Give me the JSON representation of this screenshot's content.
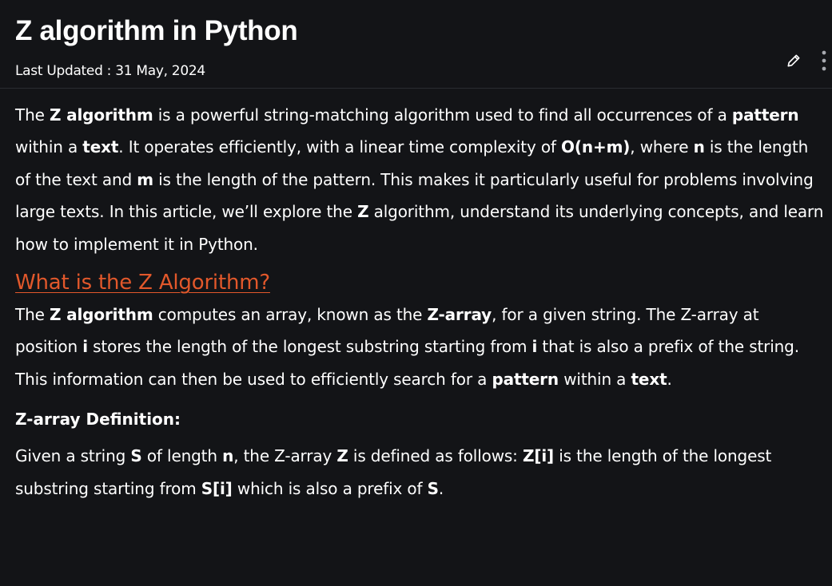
{
  "article": {
    "title": "Z algorithm in Python",
    "updated": "Last Updated : 31 May, 2024"
  },
  "icons": {
    "edit": "pencil-icon",
    "more": "more-vertical-icon"
  },
  "intro": {
    "t1": "The ",
    "b1": "Z algorithm",
    "t2": " is a powerful string-matching algorithm used to find all occurrences of a ",
    "b2": "pattern",
    "t3": " within a ",
    "b3": "text",
    "t4": ". It operates efficiently, with a linear time complexity of ",
    "b4": "O(n+m)",
    "t5": ", where ",
    "b5": "n",
    "t6": " is the length of the text and ",
    "b6": "m",
    "t7": " is the length of the pattern. This makes it particularly useful for problems involving large texts. In this article, we’ll explore the ",
    "b7": "Z",
    "t8": " algorithm, understand its underlying concepts, and learn how to implement it in Python."
  },
  "section": {
    "heading": "What is the Z Algorithm?",
    "t1": "The ",
    "b1": "Z algorithm",
    "t2": " computes an array, known as the ",
    "b2": "Z-array",
    "t3": ", for a given string. The Z-array at position ",
    "b3": "i",
    "t4": " stores the length of the longest substring starting from ",
    "b4": "i",
    "t5": " that is also a prefix of the string. This information can then be used to efficiently search for a ",
    "b5": "pattern",
    "t6": " within a ",
    "b6": "text",
    "t7": "."
  },
  "definition": {
    "heading": "Z-array Definition:",
    "t1": "Given a string ",
    "b1": "S",
    "t2": " of length ",
    "b2": "n",
    "t3": ", the Z-array ",
    "b3": "Z",
    "t4": " is defined as follows: ",
    "b4": "Z[i]",
    "t5": " is the length of the longest substring starting from ",
    "b5": "S[i]",
    "t6": " which is also a prefix of ",
    "b6": "S",
    "t7": "."
  }
}
